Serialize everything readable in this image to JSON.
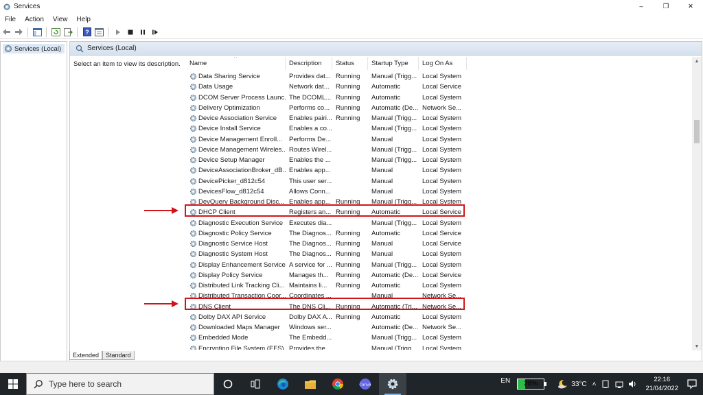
{
  "window": {
    "title": "Services",
    "controls": {
      "minimize": "–",
      "maximize": "❐",
      "close": "✕"
    }
  },
  "menu": [
    "File",
    "Action",
    "View",
    "Help"
  ],
  "tree": {
    "item": "Services (Local)"
  },
  "pane": {
    "header": "Services (Local)",
    "description": "Select an item to view its description."
  },
  "columns": [
    "Name",
    "Description",
    "Status",
    "Startup Type",
    "Log On As"
  ],
  "services": [
    [
      "Data Sharing Service",
      "Provides dat...",
      "Running",
      "Manual (Trigg...",
      "Local System"
    ],
    [
      "Data Usage",
      "Network dat...",
      "Running",
      "Automatic",
      "Local Service"
    ],
    [
      "DCOM Server Process Launc...",
      "The DCOML...",
      "Running",
      "Automatic",
      "Local System"
    ],
    [
      "Delivery Optimization",
      "Performs co...",
      "Running",
      "Automatic (De...",
      "Network Se..."
    ],
    [
      "Device Association Service",
      "Enables pairi...",
      "Running",
      "Manual (Trigg...",
      "Local System"
    ],
    [
      "Device Install Service",
      "Enables a co...",
      "",
      "Manual (Trigg...",
      "Local System"
    ],
    [
      "Device Management Enroll...",
      "Performs De...",
      "",
      "Manual",
      "Local System"
    ],
    [
      "Device Management Wireles...",
      "Routes Wirel...",
      "",
      "Manual (Trigg...",
      "Local System"
    ],
    [
      "Device Setup Manager",
      "Enables the ...",
      "",
      "Manual (Trigg...",
      "Local System"
    ],
    [
      "DeviceAssociationBroker_dB...",
      "Enables app...",
      "",
      "Manual",
      "Local System"
    ],
    [
      "DevicePicker_d812c54",
      "This user ser...",
      "",
      "Manual",
      "Local System"
    ],
    [
      "DevicesFlow_d812c54",
      "Allows Conn...",
      "",
      "Manual",
      "Local System"
    ],
    [
      "DevQuery Background Disc...",
      "Enables app...",
      "Running",
      "Manual (Trigg...",
      "Local System"
    ],
    [
      "DHCP Client",
      "Registers an...",
      "Running",
      "Automatic",
      "Local Service"
    ],
    [
      "Diagnostic Execution Service",
      "Executes dia...",
      "",
      "Manual (Trigg...",
      "Local System"
    ],
    [
      "Diagnostic Policy Service",
      "The Diagnos...",
      "Running",
      "Automatic",
      "Local Service"
    ],
    [
      "Diagnostic Service Host",
      "The Diagnos...",
      "Running",
      "Manual",
      "Local Service"
    ],
    [
      "Diagnostic System Host",
      "The Diagnos...",
      "Running",
      "Manual",
      "Local System"
    ],
    [
      "Display Enhancement Service",
      "A service for ...",
      "Running",
      "Manual (Trigg...",
      "Local System"
    ],
    [
      "Display Policy Service",
      "Manages th...",
      "Running",
      "Automatic (De...",
      "Local Service"
    ],
    [
      "Distributed Link Tracking Cli...",
      "Maintains li...",
      "Running",
      "Automatic",
      "Local System"
    ],
    [
      "Distributed Transaction Coor...",
      "Coordinates ...",
      "",
      "Manual",
      "Network Se..."
    ],
    [
      "DNS Client",
      "The DNS Cli...",
      "Running",
      "Automatic (Tri...",
      "Network Se..."
    ],
    [
      "Dolby DAX API Service",
      "Dolby DAX A...",
      "Running",
      "Automatic",
      "Local System"
    ],
    [
      "Downloaded Maps Manager",
      "Windows ser...",
      "",
      "Automatic (De...",
      "Network Se..."
    ],
    [
      "Embedded Mode",
      "The Embedd...",
      "",
      "Manual (Trigg...",
      "Local System"
    ],
    [
      "Encrypting File System (EFS)",
      "Provides the...",
      "",
      "Manual (Trigg...",
      "Local System"
    ]
  ],
  "tabs": [
    "Extended",
    "Standard"
  ],
  "taskbar": {
    "search_placeholder": "Type here to search",
    "language": "EN",
    "battery": "28%",
    "temperature": "33°C",
    "time": "22:16",
    "date": "21/04/2022"
  },
  "colors": {
    "highlight": "#d0141a",
    "taskbar": "#1f2529"
  }
}
